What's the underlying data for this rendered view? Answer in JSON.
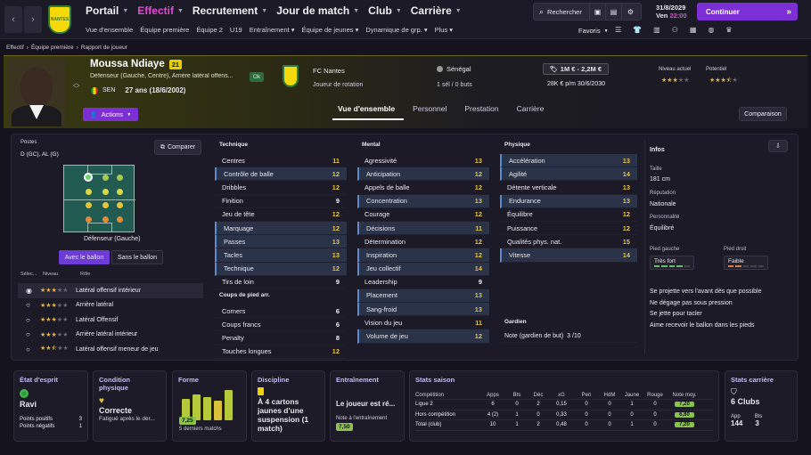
{
  "nav": {
    "main": [
      "Portail",
      "Effectif",
      "Recrutement",
      "Jour de match",
      "Club",
      "Carrière"
    ],
    "active": "Effectif",
    "sub": [
      "Vue d'ensemble",
      "Équipe première",
      "Équipe 2",
      "U19",
      "Entraînement ▾",
      "Équipe de jeunes ▾",
      "Dynamique de grp. ▾",
      "Plus ▾"
    ],
    "search": "Rechercher",
    "date": "31/8/2029",
    "day": "Ven",
    "time": "22:00",
    "continue": "Continuer",
    "favoris": "Favoris"
  },
  "crest_text": "NANTES",
  "breadcrumb": [
    "Effectif",
    "Équipe première",
    "Rapport de joueur"
  ],
  "player": {
    "name": "Moussa Ndiaye",
    "age_badge": "21",
    "position": "Défenseur (Gauche, Centre), Arrière latéral offens...",
    "nation": "SEN",
    "age": "27 ans (18/6/2002)",
    "status": "Ok",
    "club": "FC Nantes",
    "role": "Joueur de rotation",
    "country": "Sénégal",
    "caps": "1 sél / 0 buts",
    "value": "1M € - 2,2M €",
    "wage": "28K € p/m 30/6/2030",
    "current_label": "Niveau actuel",
    "potential_label": "Potentiel",
    "actions": "Actions",
    "compare_btn": "Comparaison"
  },
  "tabs": [
    "Vue d'ensemble",
    "Personnel",
    "Prestation",
    "Carrière"
  ],
  "positions": {
    "title": "Postes",
    "pos": "D (GC), AL (G)",
    "compare": "Comparer",
    "label": "Défenseur (Gauche)",
    "with_ball": "Avec le ballon",
    "without_ball": "Sans le ballon",
    "cols": [
      "Sélec...",
      "Niveau",
      "Rôle"
    ],
    "roles": [
      "Latéral offensif intérieur",
      "Arrière latéral",
      "Latéral Offensif",
      "Arrière latéral intérieur",
      "Latéral offensif meneur de jeu"
    ]
  },
  "technique": {
    "title": "Technique",
    "rows": [
      [
        "Centres",
        "11"
      ],
      [
        "Contrôle de balle",
        "12"
      ],
      [
        "Dribbles",
        "12"
      ],
      [
        "Finition",
        "9"
      ],
      [
        "Jeu de tête",
        "12"
      ],
      [
        "Marquage",
        "12"
      ],
      [
        "Passes",
        "13"
      ],
      [
        "Tacles",
        "13"
      ],
      [
        "Technique",
        "12"
      ],
      [
        "Tirs de loin",
        "9"
      ]
    ]
  },
  "setpieces": {
    "title": "Coups de pied arr.",
    "rows": [
      [
        "Corners",
        "6"
      ],
      [
        "Coups francs",
        "6"
      ],
      [
        "Penalty",
        "8"
      ],
      [
        "Touches longues",
        "12"
      ]
    ]
  },
  "mental": {
    "title": "Mental",
    "rows": [
      [
        "Agressivité",
        "13"
      ],
      [
        "Anticipation",
        "12"
      ],
      [
        "Appels de balle",
        "12"
      ],
      [
        "Concentration",
        "13"
      ],
      [
        "Courage",
        "12"
      ],
      [
        "Décisions",
        "11"
      ],
      [
        "Détermination",
        "12"
      ],
      [
        "Inspiration",
        "12"
      ],
      [
        "Jeu collectif",
        "14"
      ],
      [
        "Leadership",
        "9"
      ],
      [
        "Placement",
        "13"
      ],
      [
        "Sang-froid",
        "13"
      ],
      [
        "Vision du jeu",
        "11"
      ],
      [
        "Volume de jeu",
        "12"
      ]
    ]
  },
  "physique": {
    "title": "Physique",
    "rows": [
      [
        "Accélération",
        "13"
      ],
      [
        "Agilité",
        "14"
      ],
      [
        "Détente verticale",
        "13"
      ],
      [
        "Endurance",
        "13"
      ],
      [
        "Équilibre",
        "12"
      ],
      [
        "Puissance",
        "12"
      ],
      [
        "Qualités phys. nat.",
        "15"
      ],
      [
        "Vitesse",
        "14"
      ]
    ]
  },
  "goalkeeper": {
    "title": "Gardien",
    "label": "Note (gardien de but)",
    "value": "3 /10"
  },
  "info": {
    "title": "Infos",
    "height_label": "Taille",
    "height": "181 cm",
    "rep_label": "Réputation",
    "rep": "Nationale",
    "pers_label": "Personnalité",
    "pers": "Équilibré",
    "lf_label": "Pied gauche",
    "lf": "Très fort",
    "rf_label": "Pied droit",
    "rf": "Faible",
    "traits": [
      "Se projette vers l'avant dès que possible",
      "Ne dégage pas sous pression",
      "Se jette pour tacler",
      "Aime recevoir le ballon dans les pieds"
    ]
  },
  "cards": {
    "mood": {
      "title": "État d'esprit",
      "value": "Ravi",
      "pos_label": "Points positifs",
      "pos": "3",
      "neg_label": "Points négatifs",
      "neg": "1"
    },
    "condition": {
      "title": "Condition physique",
      "value": "Correcte",
      "note": "Fatigué après le der..."
    },
    "form": {
      "title": "Forme",
      "avg": "7,25",
      "note": "5 derniers matchs",
      "bars": [
        7.0,
        7.4,
        7.2,
        6.8,
        7.8
      ]
    },
    "discipline": {
      "title": "Discipline",
      "text": "À 4 cartons jaunes d'une suspension (1 match)"
    },
    "training": {
      "title": "Entraînement",
      "text": "Le joueur est ré...",
      "note_label": "Note à l'entraînement",
      "note": "7,50"
    },
    "season": {
      "title": "Stats saison",
      "cols": [
        "Compétition",
        "Apps",
        "Bts",
        "Déc",
        "xG",
        "Pen",
        "HdM",
        "Jaune",
        "Rouge",
        "Note moy."
      ],
      "rows": [
        [
          "Ligue 2",
          "6",
          "0",
          "2",
          "0,15",
          "0",
          "0",
          "1",
          "0",
          "7,20"
        ],
        [
          "Hors compétition",
          "4 (2)",
          "1",
          "0",
          "0,33",
          "0",
          "0",
          "0",
          "0",
          "6,80"
        ],
        [
          "Total (club)",
          "10",
          "1",
          "2",
          "0,48",
          "0",
          "0",
          "1",
          "0",
          "7,20"
        ]
      ]
    },
    "career": {
      "title": "Stats carrière",
      "clubs": "6 Clubs",
      "app_label": "App",
      "app": "144",
      "bts_label": "Bts",
      "bts": "3"
    }
  },
  "colors": {
    "accent": "#e14bd3",
    "purple": "#7b2fd4",
    "yellow": "#e6c43a"
  },
  "ratings": {
    "current": 3,
    "potential": 3.5
  }
}
